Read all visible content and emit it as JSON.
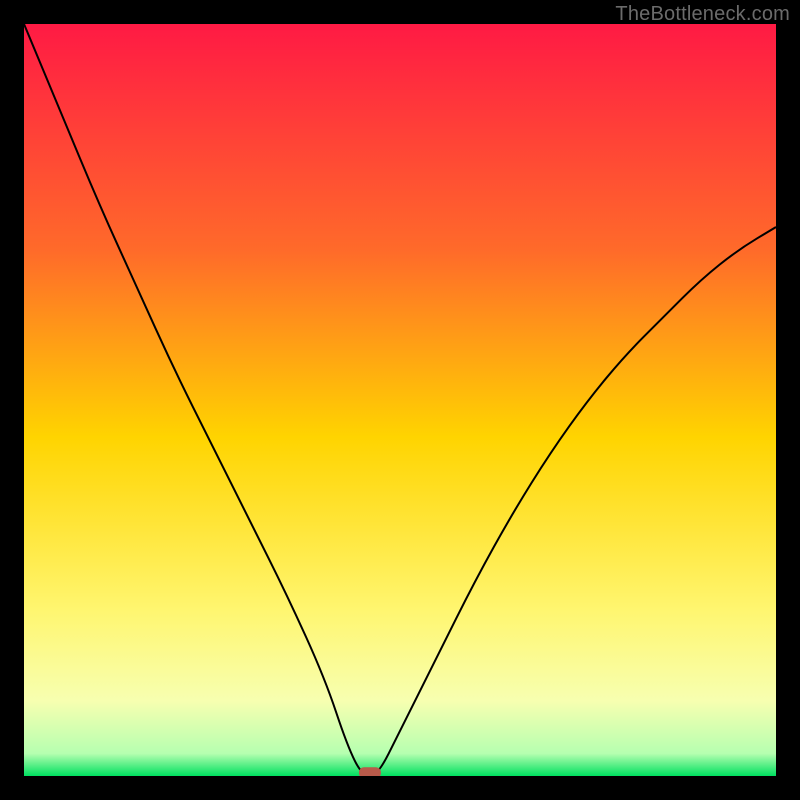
{
  "watermark": "TheBottleneck.com",
  "chart_data": {
    "type": "line",
    "title": "",
    "xlabel": "",
    "ylabel": "",
    "xlim": [
      0,
      100
    ],
    "ylim": [
      0,
      100
    ],
    "grid": false,
    "legend": false,
    "gradient_stops": [
      {
        "offset": 0.0,
        "color": "#ff1a44"
      },
      {
        "offset": 0.3,
        "color": "#ff6a2a"
      },
      {
        "offset": 0.55,
        "color": "#ffd400"
      },
      {
        "offset": 0.78,
        "color": "#fff670"
      },
      {
        "offset": 0.9,
        "color": "#f7ffb0"
      },
      {
        "offset": 0.97,
        "color": "#b6ffb0"
      },
      {
        "offset": 1.0,
        "color": "#00e060"
      }
    ],
    "series": [
      {
        "name": "bottleneck-curve",
        "color": "#000000",
        "x": [
          0,
          5,
          10,
          15,
          20,
          25,
          30,
          35,
          40,
          43,
          45,
          47,
          50,
          55,
          60,
          65,
          70,
          75,
          80,
          85,
          90,
          95,
          100
        ],
        "y": [
          100,
          88,
          76,
          65,
          54,
          44,
          34,
          24,
          13,
          4,
          0,
          0,
          6,
          16,
          26,
          35,
          43,
          50,
          56,
          61,
          66,
          70,
          73
        ]
      }
    ],
    "marker": {
      "name": "min-point",
      "x": 46,
      "y": 0.5,
      "color": "#b85a4a"
    }
  }
}
